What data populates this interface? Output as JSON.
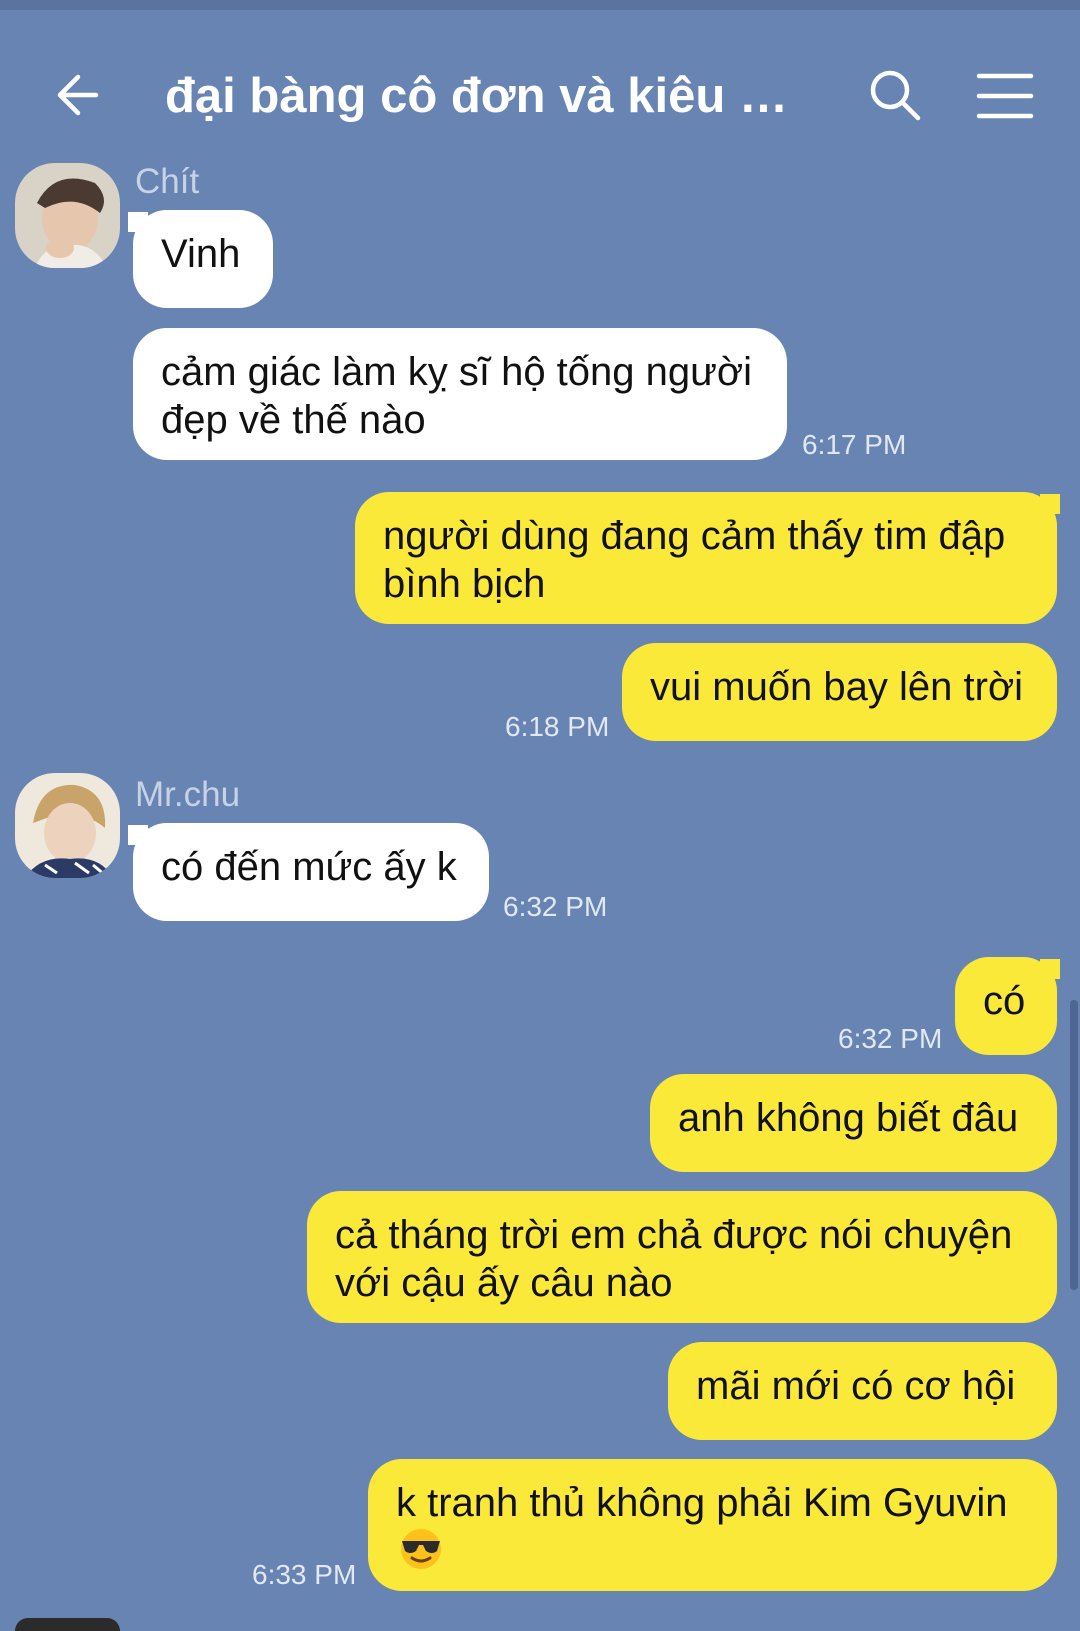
{
  "header": {
    "title": "đại bàng cô đơn và kiêu hã..."
  },
  "colors": {
    "background": "#6884b3",
    "incoming_bubble": "#ffffff",
    "outgoing_bubble": "#fbe93a",
    "timestamp": "#e2e8f2",
    "sender_name": "#c6d2e6"
  },
  "messages": [
    {
      "id": "m1",
      "direction": "incoming",
      "sender": "Chít",
      "text": "Vinh",
      "time": ""
    },
    {
      "id": "m2",
      "direction": "incoming",
      "sender": "",
      "text": "cảm giác làm kỵ sĩ hộ tống người đẹp về thế nào",
      "time": "6:17 PM"
    },
    {
      "id": "m3",
      "direction": "outgoing",
      "text": "người dùng đang cảm thấy tim đập bình bịch",
      "time": ""
    },
    {
      "id": "m4",
      "direction": "outgoing",
      "text": "vui muốn bay lên trời",
      "time": "6:18 PM"
    },
    {
      "id": "m5",
      "direction": "incoming",
      "sender": "Mr.chu",
      "text": "có đến mức ấy k",
      "time": "6:32 PM"
    },
    {
      "id": "m6",
      "direction": "outgoing",
      "text": "có",
      "time": "6:32 PM"
    },
    {
      "id": "m7",
      "direction": "outgoing",
      "text": "anh không biết đâu",
      "time": ""
    },
    {
      "id": "m8",
      "direction": "outgoing",
      "text": "cả tháng trời em chả được nói chuyện với cậu ấy câu nào",
      "time": ""
    },
    {
      "id": "m9",
      "direction": "outgoing",
      "text": "mãi mới có cơ hội",
      "time": ""
    },
    {
      "id": "m10",
      "direction": "outgoing",
      "text": "k tranh thủ không phải Kim Gyuvin",
      "emoji": "sunglasses-emoji",
      "time": "6:33 PM"
    }
  ]
}
